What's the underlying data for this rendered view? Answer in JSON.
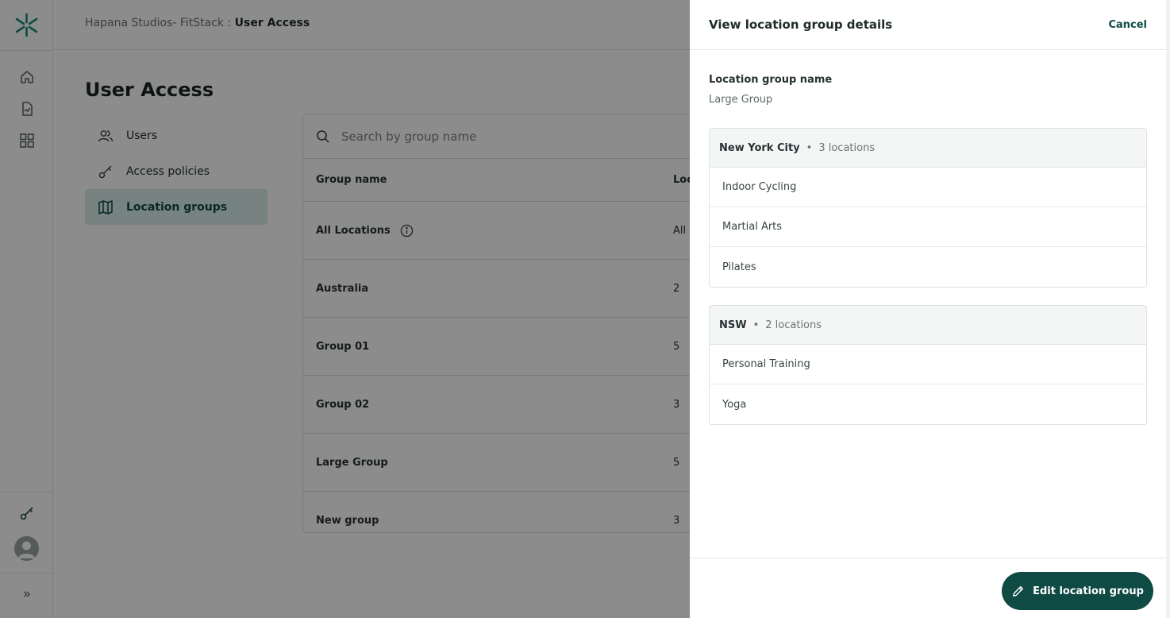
{
  "topbar": {
    "org": "Hapana Studios- FitStack :",
    "current": "User Access"
  },
  "page": {
    "title": "User Access"
  },
  "side_nav": {
    "items": [
      {
        "label": "Users",
        "icon": "users-icon"
      },
      {
        "label": "Access policies",
        "icon": "key-icon"
      },
      {
        "label": "Location groups",
        "icon": "map-icon",
        "active": true
      }
    ]
  },
  "search": {
    "placeholder": "Search by group name"
  },
  "table": {
    "headers": {
      "name": "Group name",
      "locations": "Loc"
    },
    "rows": [
      {
        "name": "All Locations",
        "locations": "All",
        "info": true
      },
      {
        "name": "Australia",
        "locations": "2"
      },
      {
        "name": "Group 01",
        "locations": "5"
      },
      {
        "name": "Group 02",
        "locations": "3"
      },
      {
        "name": "Large Group",
        "locations": "5"
      },
      {
        "name": "New group",
        "locations": "3"
      }
    ]
  },
  "drawer": {
    "title": "View location group details",
    "cancel_label": "Cancel",
    "field_label": "Location group name",
    "field_value": "Large Group",
    "groups": [
      {
        "name": "New York City",
        "dot": "•",
        "count": "3 locations",
        "locations": [
          "Indoor Cycling",
          "Martial Arts",
          "Pilates"
        ]
      },
      {
        "name": "NSW",
        "dot": "•",
        "count": "2 locations",
        "locations": [
          "Personal Training",
          "Yoga"
        ]
      }
    ],
    "edit_label": "Edit location group"
  },
  "rail": {
    "expand_glyph": "»"
  },
  "colors": {
    "brand": "#0f4a45",
    "active_bg": "#d7efe9",
    "logo": "#1a8a7a"
  }
}
